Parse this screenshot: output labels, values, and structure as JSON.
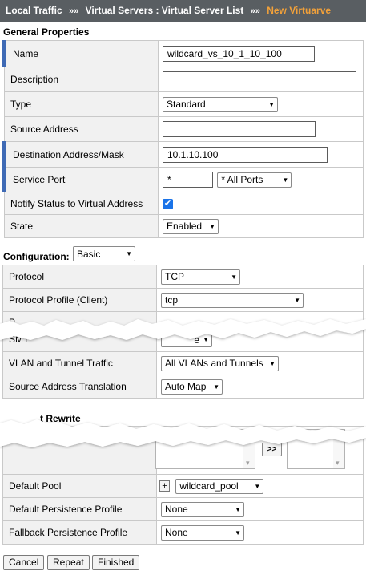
{
  "breadcrumb": {
    "items": [
      "Local Traffic",
      "Virtual Servers : Virtual Server List"
    ],
    "separator": "»»",
    "current": "New Virtuarve"
  },
  "general": {
    "title": "General Properties",
    "name_label": "Name",
    "name_value": "wildcard_vs_10_1_10_100",
    "description_label": "Description",
    "description_value": "",
    "type_label": "Type",
    "type_value": "Standard",
    "source_label": "Source Address",
    "source_value": "",
    "dest_label": "Destination Address/Mask",
    "dest_value": "10.1.10.100",
    "port_label": "Service Port",
    "port_value": "*",
    "port_select": "* All Ports",
    "notify_label": "Notify Status to Virtual Address",
    "notify_checked": "✔",
    "state_label": "State",
    "state_value": "Enabled"
  },
  "configuration": {
    "title": "Configuration:",
    "mode": "Basic",
    "protocol_label": "Protocol",
    "protocol_value": "TCP",
    "client_profile_label": "Protocol Profile (Client)",
    "client_profile_value": "tcp",
    "partial_label_1": "P",
    "partial_label_2": "SMT",
    "partial_value": "e",
    "vlan_label": "VLAN and Tunnel Traffic",
    "vlan_value": "All VLANs and Tunnels",
    "snat_label": "Source Address Translation",
    "snat_value": "Auto Map"
  },
  "resources": {
    "partial_title": "t Rewrite",
    "move_button": ">>",
    "default_pool_label": "Default Pool",
    "add_pool_button": "+",
    "default_pool_value": "wildcard_pool",
    "persist_label": "Default Persistence Profile",
    "persist_value": "None",
    "fallback_label": "Fallback Persistence Profile",
    "fallback_value": "None"
  },
  "buttons": {
    "cancel": "Cancel",
    "repeat": "Repeat",
    "finished": "Finished"
  },
  "colors": {
    "breadcrumb_bg": "#595e62",
    "breadcrumb_current": "#f2a13a",
    "required_marker": "#3f6ab5",
    "checkbox": "#1a73e8"
  }
}
